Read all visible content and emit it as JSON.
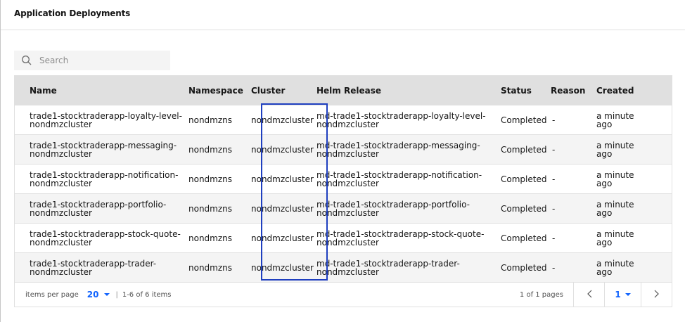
{
  "page": {
    "title": "Application Deployments"
  },
  "search": {
    "placeholder": "Search"
  },
  "table": {
    "columns": {
      "name": "Name",
      "namespace": "Namespace",
      "cluster": "Cluster",
      "helm_release": "Helm Release",
      "status": "Status",
      "reason": "Reason",
      "created": "Created"
    },
    "rows": [
      {
        "name": "trade1-stocktraderapp-loyalty-level-nondmzcluster",
        "namespace": "nondmzns",
        "cluster": "nondmzcluster",
        "helm_release": "md-trade1-stocktraderapp-loyalty-level-nondmzcluster",
        "status": "Completed",
        "reason": "-",
        "created": "a minute ago"
      },
      {
        "name": "trade1-stocktraderapp-messaging-nondmzcluster",
        "namespace": "nondmzns",
        "cluster": "nondmzcluster",
        "helm_release": "md-trade1-stocktraderapp-messaging-nondmzcluster",
        "status": "Completed",
        "reason": "-",
        "created": "a minute ago"
      },
      {
        "name": "trade1-stocktraderapp-notification-nondmzcluster",
        "namespace": "nondmzns",
        "cluster": "nondmzcluster",
        "helm_release": "md-trade1-stocktraderapp-notification-nondmzcluster",
        "status": "Completed",
        "reason": "-",
        "created": "a minute ago"
      },
      {
        "name": "trade1-stocktraderapp-portfolio-nondmzcluster",
        "namespace": "nondmzns",
        "cluster": "nondmzcluster",
        "helm_release": "md-trade1-stocktraderapp-portfolio-nondmzcluster",
        "status": "Completed",
        "reason": "-",
        "created": "a minute ago"
      },
      {
        "name": "trade1-stocktraderapp-stock-quote-nondmzcluster",
        "namespace": "nondmzns",
        "cluster": "nondmzcluster",
        "helm_release": "md-trade1-stocktraderapp-stock-quote-nondmzcluster",
        "status": "Completed",
        "reason": "-",
        "created": "a minute ago"
      },
      {
        "name": "trade1-stocktraderapp-trader-nondmzcluster",
        "namespace": "nondmzns",
        "cluster": "nondmzcluster",
        "helm_release": "md-trade1-stocktraderapp-trader-nondmzcluster",
        "status": "Completed",
        "reason": "-",
        "created": "a minute ago"
      }
    ]
  },
  "pagination": {
    "items_per_page_label": "items per page",
    "items_per_page_value": "20",
    "separator": "|",
    "range_label": "1-6 of 6 items",
    "pages_label": "1 of 1 pages",
    "current_page": "1"
  },
  "icons": {
    "search": "search-icon",
    "chevron_down": "chevron-down-icon",
    "prev": "chevron-left-icon",
    "next": "chevron-right-icon"
  },
  "colors": {
    "accent": "#0f62fe",
    "highlight_box": "#1f3fbf",
    "header_bg": "#e0e0e0",
    "zebra": "#f4f4f4"
  }
}
